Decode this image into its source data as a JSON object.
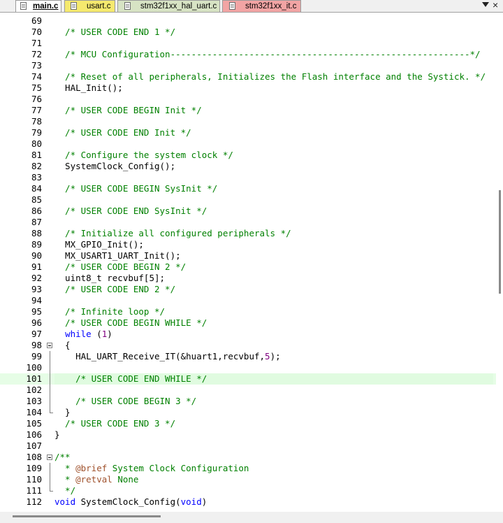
{
  "tabs": [
    {
      "label": "main.c",
      "active": true,
      "color": "#ffffff"
    },
    {
      "label": "usart.c",
      "active": false,
      "color": "#f5e96e"
    },
    {
      "label": "stm32f1xx_hal_uart.c",
      "active": false,
      "color": "#d7e3c4"
    },
    {
      "label": "stm32f1xx_it.c",
      "active": false,
      "color": "#f2a4a4"
    }
  ],
  "tab_controls": {
    "menu_icon": "chevron-down-icon",
    "close": "×"
  },
  "theme": {
    "comment": "#008000",
    "keyword": "#0000ff",
    "doc_tag": "#a0522d",
    "number": "#800080",
    "current_line": "#e0fbe0"
  },
  "editor": {
    "current_line": 101,
    "lines": [
      {
        "n": "69",
        "text": ""
      },
      {
        "n": "70",
        "text": "  /* USER CODE END 1 */"
      },
      {
        "n": "71",
        "text": ""
      },
      {
        "n": "72",
        "text": "  /* MCU Configuration---------------------------------------------------------*/"
      },
      {
        "n": "73",
        "text": ""
      },
      {
        "n": "74",
        "text": "  /* Reset of all peripherals, Initializes the Flash interface and the Systick. */"
      },
      {
        "n": "75",
        "text": "  HAL_Init();"
      },
      {
        "n": "76",
        "text": ""
      },
      {
        "n": "77",
        "text": "  /* USER CODE BEGIN Init */"
      },
      {
        "n": "78",
        "text": ""
      },
      {
        "n": "79",
        "text": "  /* USER CODE END Init */"
      },
      {
        "n": "80",
        "text": ""
      },
      {
        "n": "81",
        "text": "  /* Configure the system clock */"
      },
      {
        "n": "82",
        "text": "  SystemClock_Config();"
      },
      {
        "n": "83",
        "text": ""
      },
      {
        "n": "84",
        "text": "  /* USER CODE BEGIN SysInit */"
      },
      {
        "n": "85",
        "text": ""
      },
      {
        "n": "86",
        "text": "  /* USER CODE END SysInit */"
      },
      {
        "n": "87",
        "text": ""
      },
      {
        "n": "88",
        "text": "  /* Initialize all configured peripherals */"
      },
      {
        "n": "89",
        "text": "  MX_GPIO_Init();"
      },
      {
        "n": "90",
        "text": "  MX_USART1_UART_Init();"
      },
      {
        "n": "91",
        "text": "  /* USER CODE BEGIN 2 */"
      },
      {
        "n": "92",
        "text": "  uint8_t recvbuf[5];"
      },
      {
        "n": "93",
        "text": "  /* USER CODE END 2 */"
      },
      {
        "n": "94",
        "text": ""
      },
      {
        "n": "95",
        "text": "  /* Infinite loop */"
      },
      {
        "n": "96",
        "text": "  /* USER CODE BEGIN WHILE */"
      },
      {
        "n": "97",
        "text": "  while (1)"
      },
      {
        "n": "98",
        "text": "  {"
      },
      {
        "n": "99",
        "text": "    HAL_UART_Receive_IT(&huart1,recvbuf,5);"
      },
      {
        "n": "100",
        "text": ""
      },
      {
        "n": "101",
        "text": "    /* USER CODE END WHILE */"
      },
      {
        "n": "102",
        "text": ""
      },
      {
        "n": "103",
        "text": "    /* USER CODE BEGIN 3 */"
      },
      {
        "n": "104",
        "text": "  }"
      },
      {
        "n": "105",
        "text": "  /* USER CODE END 3 */"
      },
      {
        "n": "106",
        "text": "}"
      },
      {
        "n": "107",
        "text": ""
      },
      {
        "n": "108",
        "text": "/**"
      },
      {
        "n": "109",
        "text": "  * @brief System Clock Configuration"
      },
      {
        "n": "110",
        "text": "  * @retval None"
      },
      {
        "n": "111",
        "text": "  */"
      },
      {
        "n": "112",
        "text": "void SystemClock_Config(void)"
      }
    ]
  }
}
